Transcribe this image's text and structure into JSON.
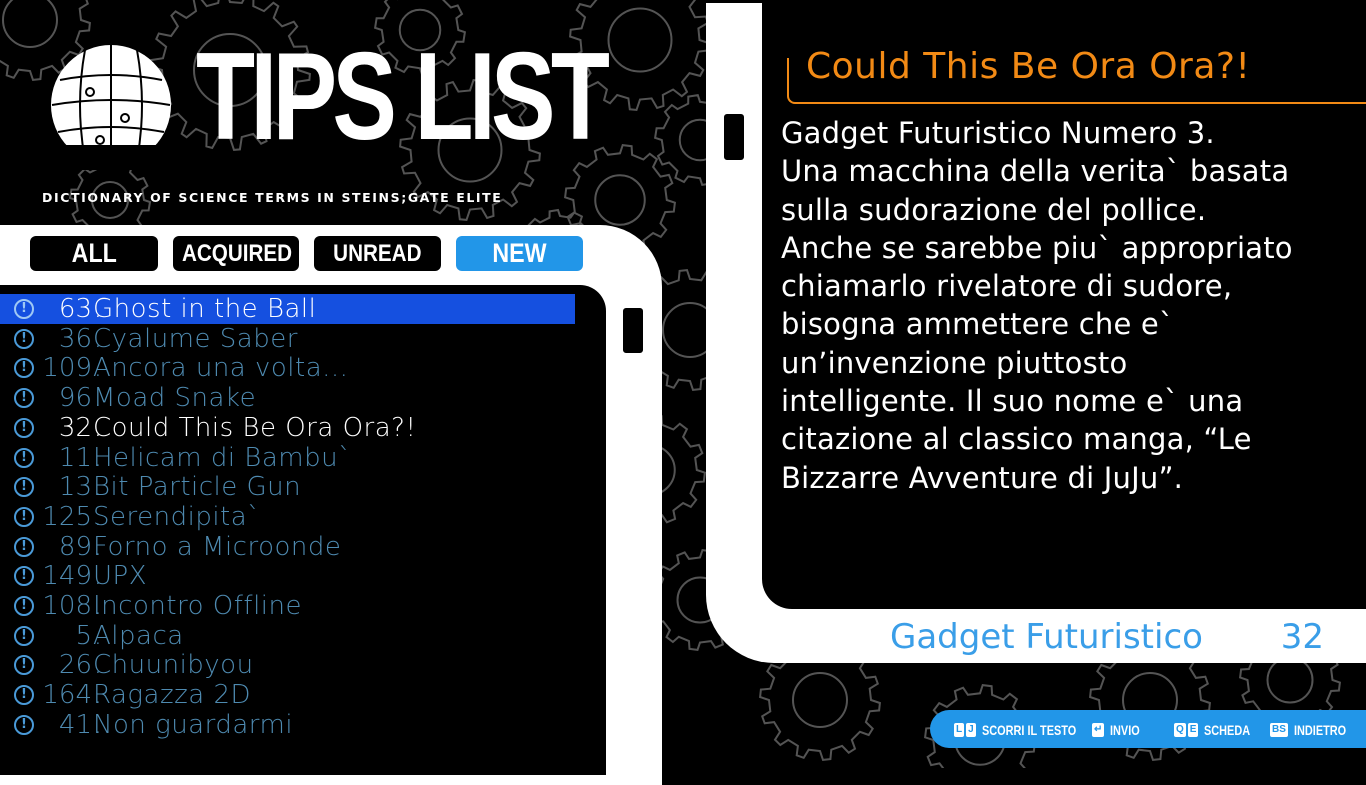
{
  "header": {
    "title": "TIPS LIST",
    "subtitle": "DICTIONARY OF SCIENCE TERMS IN STEINS;GATE ELITE"
  },
  "tabs": [
    {
      "label": "ALL",
      "active": false
    },
    {
      "label": "ACQUIRED",
      "active": false
    },
    {
      "label": "UNREAD",
      "active": false
    },
    {
      "label": "NEW",
      "active": true
    }
  ],
  "tips": [
    {
      "num": "63",
      "name": "Ghost in the Ball",
      "selected": true
    },
    {
      "num": "36",
      "name": "Cyalume Saber"
    },
    {
      "num": "109",
      "name": "Ancora una volta..."
    },
    {
      "num": "96",
      "name": "Moad Snake"
    },
    {
      "num": "32",
      "name": "Could This Be Ora Ora?!",
      "read": true
    },
    {
      "num": "11",
      "name": "Helicam di Bambu`"
    },
    {
      "num": "13",
      "name": "Bit Particle Gun"
    },
    {
      "num": "125",
      "name": "Serendipita`"
    },
    {
      "num": "89",
      "name": "Forno a Microonde"
    },
    {
      "num": "149",
      "name": "UPX"
    },
    {
      "num": "108",
      "name": "Incontro Offline"
    },
    {
      "num": "5",
      "name": "Alpaca"
    },
    {
      "num": "26",
      "name": "Chuunibyou"
    },
    {
      "num": "164",
      "name": "Ragazza 2D"
    },
    {
      "num": "41",
      "name": "Non guardarmi"
    }
  ],
  "detail": {
    "title": "Could This Be Ora Ora?!",
    "body": "Gadget Futuristico Numero 3.\nUna macchina della verita` basata\nsulla sudorazione del pollice.\nAnche se sarebbe piu` appropriato\nchiamarlo rivelatore di sudore,\nbisogna ammettere che e`\nun’invenzione piuttosto\nintelligente. Il suo nome e` una\ncitazione al classico manga, “Le\nBizzarre Avventure di JuJu”.",
    "category": "Gadget Futuristico",
    "number": "32"
  },
  "footer": [
    {
      "keys": [
        "L",
        "J"
      ],
      "label": "SCORRI IL TESTO"
    },
    {
      "keys": [
        "↵"
      ],
      "label": "INVIO"
    },
    {
      "keys": [
        "Q",
        "E"
      ],
      "label": "SCHEDA"
    },
    {
      "keys": [
        "BS"
      ],
      "label": "INDIETRO"
    }
  ],
  "colors": {
    "accent_blue": "#2296e8",
    "selection_blue": "#1550e0",
    "title_orange": "#f28a15",
    "unread_text": "#4e8ab0"
  }
}
